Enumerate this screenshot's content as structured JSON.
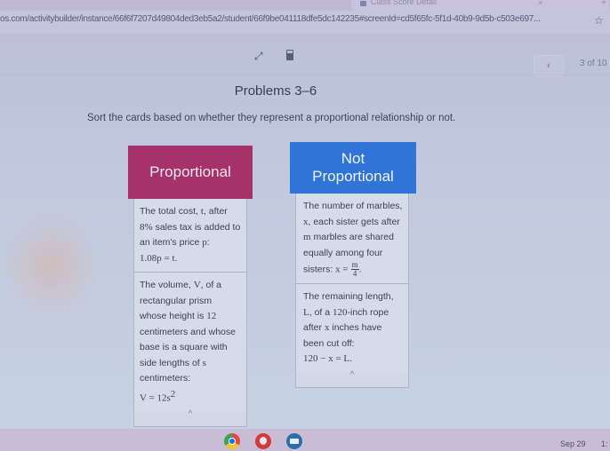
{
  "browser": {
    "tab_title": "Class Score Detail",
    "tab_close": "×",
    "new_tab": "+",
    "url": "os.com/activitybuilder/instance/66f6f7207d49804ded3eb5a2/student/66f9be041118dfe5dc142235#screenId=cd5f65fc-5f1d-40b9-9d5b-c503e697...",
    "bookmark_icon": "☆"
  },
  "toolbar": {
    "expand_icon": "⤢",
    "prev_icon": "‹",
    "page_indicator": "3 of 10"
  },
  "main": {
    "title": "Problems 3–6",
    "instructions": "Sort the cards based on whether they represent a proportional relationship or not."
  },
  "columns": [
    {
      "header": "Proportional",
      "color": "#a53269",
      "cards": [
        {
          "text_parts": [
            "The total cost, ",
            "t",
            ", after ",
            "8%",
            " sales tax is added to an item's price ",
            "p",
            ": ",
            "1.08p = t",
            "."
          ]
        },
        {
          "text_parts": [
            "The volume, ",
            "V",
            ", of a rectangular prism whose height is ",
            "12",
            " centimeters and whose base is a square with side lengths of ",
            "s",
            " centimeters: ",
            "V = 12s",
            "2"
          ]
        }
      ],
      "collapse_icon": "^"
    },
    {
      "header_line1": "Not",
      "header_line2": "Proportional",
      "color": "#2f74d6",
      "cards": [
        {
          "text_parts": [
            "The number of marbles, ",
            "x",
            ", each sister gets after ",
            "m",
            " marbles are shared equally among four sisters: ",
            "x =",
            "m",
            "4",
            "."
          ]
        },
        {
          "text_parts": [
            "The remaining length, ",
            "L",
            ", of a ",
            "120",
            "-inch rope after ",
            "x",
            " inches have been cut off: ",
            "120 − x = L",
            "."
          ]
        }
      ],
      "collapse_icon": "^"
    }
  ],
  "taskbar": {
    "apps": [
      "chrome-icon",
      "canvas-icon",
      "classroom-icon"
    ],
    "date": "Sep 29",
    "time": "1:"
  }
}
